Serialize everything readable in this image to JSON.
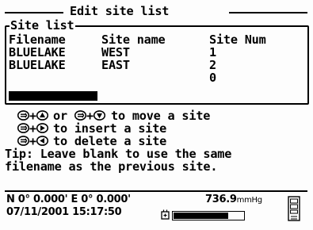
{
  "title": "Edit site list",
  "group": {
    "legend": "Site list",
    "headers": [
      "Filename",
      "Site name",
      "Site Num"
    ],
    "rows": [
      {
        "filename": "BLUELAKE",
        "site": "WEST",
        "num": "1"
      },
      {
        "filename": "BLUELAKE",
        "site": "EAST",
        "num": "2"
      }
    ],
    "new_entry_num": "0"
  },
  "instructions": {
    "move": {
      "or": "or",
      "text": "to move a site"
    },
    "insert": "to insert a site",
    "delete": "to delete a site",
    "tip_line1": "Tip: Leave blank to use the same",
    "tip_line2": "filename as the previous site."
  },
  "status": {
    "gps": "N 0° 0.000' E 0° 0.000'",
    "datetime": "07/11/2001 15:17:50",
    "pressure_value": "736.9",
    "pressure_unit": "mmHg",
    "battery_level": 0.78
  },
  "icons": [
    "enter-key-icon",
    "arrow-up-key-icon",
    "arrow-down-key-icon",
    "arrow-right-key-icon",
    "arrow-left-key-icon",
    "battery-icon",
    "probe-icon"
  ]
}
